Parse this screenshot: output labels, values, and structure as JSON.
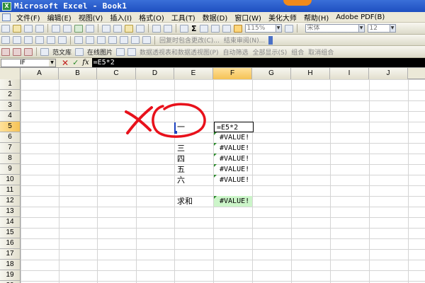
{
  "window": {
    "title": "Microsoft Excel - Book1"
  },
  "menu": {
    "items": [
      "文件(F)",
      "编辑(E)",
      "视图(V)",
      "插入(I)",
      "格式(O)",
      "工具(T)",
      "数据(D)",
      "窗口(W)",
      "美化大师",
      "帮助(H)",
      "Adobe PDF(B)"
    ]
  },
  "toolbar": {
    "sigma": "Σ",
    "zoom": "115%",
    "font_name": "宋体",
    "font_size": "12",
    "review_text": "回复时包含更改(C)...",
    "end_review": "结束审阅(N)...",
    "lib_label": "范文库",
    "online_pic": "在线图片",
    "faded_items": [
      "数据透视表和数据透视图(P)",
      "自动筛选",
      "全部显示(S)",
      "组合",
      "取消组合"
    ]
  },
  "formula_bar": {
    "name_box": "IF",
    "cancel": "✕",
    "enter": "✓",
    "fx": "fx",
    "formula": "=E5*2"
  },
  "grid": {
    "columns": [
      "A",
      "B",
      "C",
      "D",
      "E",
      "F",
      "G",
      "H",
      "I",
      "J"
    ],
    "rows": [
      "1",
      "2",
      "3",
      "4",
      "5",
      "6",
      "7",
      "8",
      "9",
      "10",
      "11",
      "12",
      "13",
      "14",
      "15",
      "16",
      "17",
      "18",
      "19",
      "20"
    ],
    "cells": {
      "E5": "一",
      "E7": "三",
      "E8": "四",
      "E9": "五",
      "E10": "六",
      "E12": "求和",
      "F5": "=E5*2",
      "F6": "#VALUE!",
      "F7": "#VALUE!",
      "F8": "#VALUE!",
      "F9": "#VALUE!",
      "F10": "#VALUE!",
      "F12": "#VALUE!"
    }
  },
  "annotation": {
    "color": "#e8111b"
  }
}
